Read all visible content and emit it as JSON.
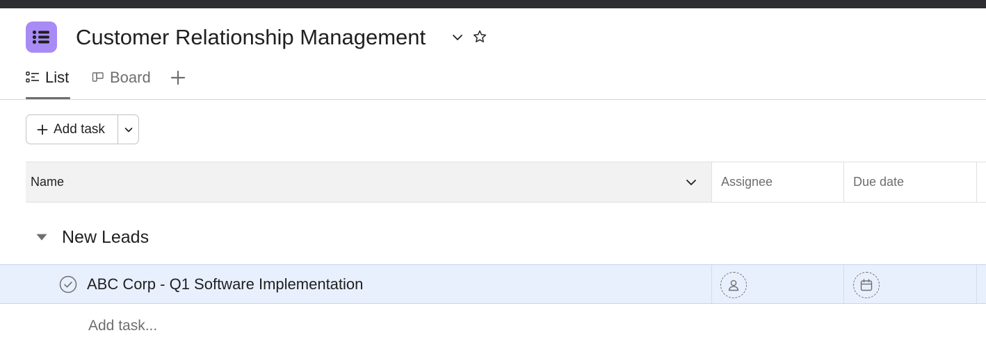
{
  "project": {
    "title": "Customer Relationship Management",
    "icon": "list-icon",
    "icon_color": "#a98bf5"
  },
  "tabs": [
    {
      "label": "List",
      "icon": "list-view-icon",
      "active": true
    },
    {
      "label": "Board",
      "icon": "board-view-icon",
      "active": false
    }
  ],
  "toolbar": {
    "add_task_label": "Add task"
  },
  "table": {
    "columns": [
      "Name",
      "Assignee",
      "Due date"
    ]
  },
  "sections": [
    {
      "title": "New Leads",
      "tasks": [
        {
          "name": "ABC Corp - Q1 Software Implementation",
          "assignee": "",
          "due_date": ""
        }
      ],
      "add_task_placeholder": "Add task..."
    }
  ],
  "colors": {
    "selected_row": "#e9f0fd",
    "header_bg": "#f2f2f2"
  }
}
